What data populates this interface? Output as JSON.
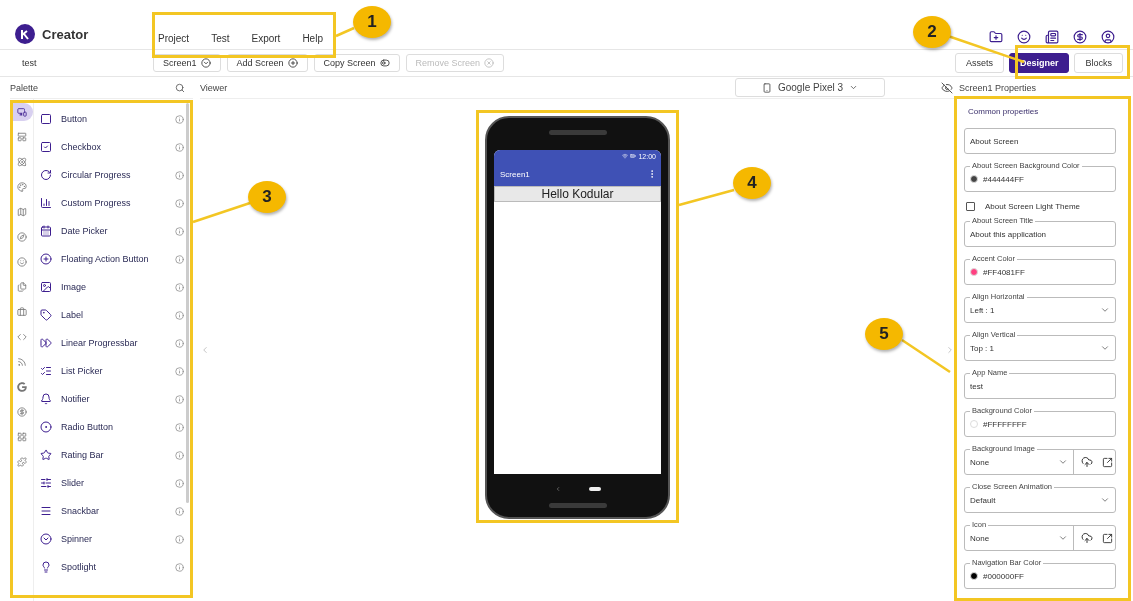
{
  "app": {
    "name": "Creator"
  },
  "menu": [
    "Project",
    "Test",
    "Export",
    "Help"
  ],
  "project_name": "test",
  "screen_buttons": [
    {
      "label": "Screen1",
      "disabled": false
    },
    {
      "label": "Add Screen",
      "disabled": false
    },
    {
      "label": "Copy Screen",
      "disabled": false
    },
    {
      "label": "Remove Screen",
      "disabled": true
    }
  ],
  "view_tabs": [
    {
      "label": "Assets",
      "selected": false
    },
    {
      "label": "Designer",
      "selected": true
    },
    {
      "label": "Blocks",
      "selected": false
    }
  ],
  "palette": {
    "title": "Palette",
    "categories": [
      {
        "selected": true
      },
      {
        "selected": false
      },
      {
        "selected": false
      },
      {
        "selected": false
      },
      {
        "selected": false
      },
      {
        "selected": false
      },
      {
        "selected": false
      },
      {
        "selected": false
      },
      {
        "selected": false
      },
      {
        "selected": false
      },
      {
        "selected": false
      },
      {
        "selected": false
      },
      {
        "selected": false
      },
      {
        "selected": false
      },
      {
        "selected": false
      }
    ],
    "items": [
      "Button",
      "Checkbox",
      "Circular Progress",
      "Custom Progress",
      "Date Picker",
      "Floating Action Button",
      "Image",
      "Label",
      "Linear Progressbar",
      "List Picker",
      "Notifier",
      "Radio Button",
      "Rating Bar",
      "Slider",
      "Snackbar",
      "Spinner",
      "Spotlight"
    ]
  },
  "viewer": {
    "title": "Viewer",
    "device": "Google Pixel 3",
    "phone": {
      "status_time": "12:00",
      "screen_title": "Screen1",
      "label": "Hello Kodular"
    }
  },
  "properties": {
    "title": "Screen1 Properties",
    "section": "Common properties",
    "fields": [
      {
        "kind": "textarea",
        "value": "About Screen"
      },
      {
        "kind": "color",
        "label": "About Screen Background Color",
        "value": "#444444FF",
        "color": "#444444"
      },
      {
        "kind": "checkbox",
        "label": "About Screen Light Theme",
        "checked": false
      },
      {
        "kind": "text",
        "label": "About Screen Title",
        "value": "About this application"
      },
      {
        "kind": "color",
        "label": "Accent Color",
        "value": "#FF4081FF",
        "color": "#ff4081"
      },
      {
        "kind": "select",
        "label": "Align Horizontal",
        "value": "Left : 1"
      },
      {
        "kind": "select",
        "label": "Align Vertical",
        "value": "Top : 1"
      },
      {
        "kind": "text",
        "label": "App Name",
        "value": "test"
      },
      {
        "kind": "color",
        "label": "Background Color",
        "value": "#FFFFFFFF",
        "color": "#ffffff"
      },
      {
        "kind": "asset",
        "label": "Background Image",
        "value": "None"
      },
      {
        "kind": "select",
        "label": "Close Screen Animation",
        "value": "Default"
      },
      {
        "kind": "asset",
        "label": "Icon",
        "value": "None"
      },
      {
        "kind": "color",
        "label": "Navigation Bar Color",
        "value": "#000000FF",
        "color": "#000000"
      }
    ]
  },
  "callouts": [
    "1",
    "2",
    "3",
    "4",
    "5"
  ]
}
